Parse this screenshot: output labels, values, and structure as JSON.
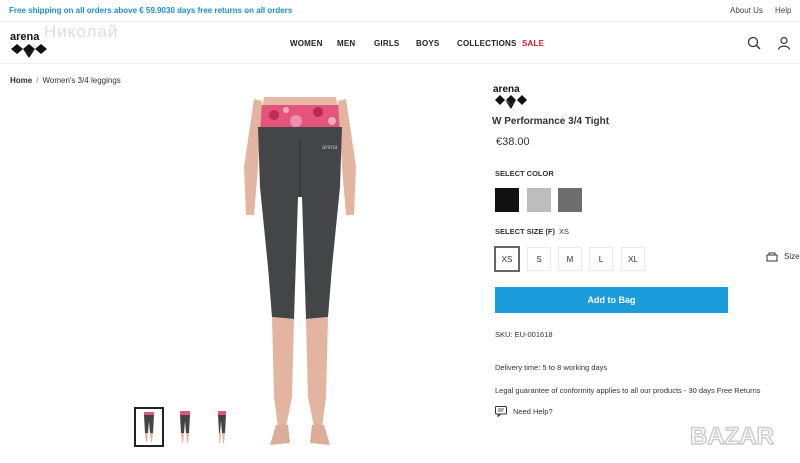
{
  "topbar": {
    "promo_shipping": "Free shipping on all orders above € 59.90",
    "promo_returns": "30 days free returns on all orders",
    "about_us": "About Us",
    "help": "Help"
  },
  "header": {
    "logo_icon": "arena-logo",
    "watermark_name": "Николай",
    "nav": [
      "WOMEN",
      "MEN",
      "GIRLS",
      "BOYS",
      "COLLECTIONS",
      "SALE"
    ],
    "search_icon": "search-icon",
    "account_icon": "user-icon"
  },
  "breadcrumb": {
    "home": "Home",
    "separator": "/",
    "current": "Women's 3/4 leggings"
  },
  "product": {
    "brand": "arena",
    "name": "W Performance 3/4 Tight",
    "price": "€38.00",
    "select_color_label": "SELECT COLOR",
    "colors": [
      "#121212",
      "#bdbdbd",
      "#6d6d6d"
    ],
    "select_size_label": "SELECT SIZE (F)",
    "selected_size": "XS",
    "sizes": [
      "XS",
      "S",
      "M",
      "L",
      "XL"
    ],
    "size_guide": "Size",
    "add_to_bag": "Add to Bag",
    "sku": "SKU: EU-001618",
    "delivery": "Delivery time: 5 to 8 working days",
    "legal": "Legal guarantee of conformity applies to all our products - 30 days Free Returns",
    "need_help": "Need Help?"
  },
  "watermark": {
    "bazar": "BAZAR"
  },
  "colors": {
    "accent": "#1a9bdb",
    "sale": "#d8192c",
    "promo": "#1a8fd0"
  }
}
